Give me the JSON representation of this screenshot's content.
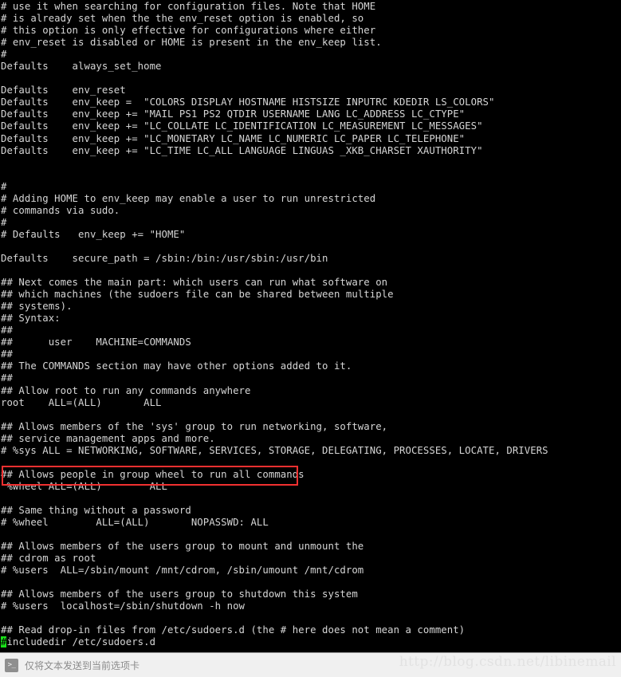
{
  "window": {
    "background": "#000000",
    "foreground": "#d6d6d6",
    "highlight_color": "#f23030",
    "cursor_color": "#19e019"
  },
  "terminal": {
    "cursor": {
      "line_index": 53,
      "column": 0,
      "character": "#"
    },
    "lines": [
      "# use it when searching for configuration files. Note that HOME",
      "# is already set when the the env_reset option is enabled, so",
      "# this option is only effective for configurations where either",
      "# env_reset is disabled or HOME is present in the env_keep list.",
      "#",
      "Defaults    always_set_home",
      "",
      "Defaults    env_reset",
      "Defaults    env_keep =  \"COLORS DISPLAY HOSTNAME HISTSIZE INPUTRC KDEDIR LS_COLORS\"",
      "Defaults    env_keep += \"MAIL PS1 PS2 QTDIR USERNAME LANG LC_ADDRESS LC_CTYPE\"",
      "Defaults    env_keep += \"LC_COLLATE LC_IDENTIFICATION LC_MEASUREMENT LC_MESSAGES\"",
      "Defaults    env_keep += \"LC_MONETARY LC_NAME LC_NUMERIC LC_PAPER LC_TELEPHONE\"",
      "Defaults    env_keep += \"LC_TIME LC_ALL LANGUAGE LINGUAS _XKB_CHARSET XAUTHORITY\"",
      "",
      "",
      "#",
      "# Adding HOME to env_keep may enable a user to run unrestricted",
      "# commands via sudo.",
      "#",
      "# Defaults   env_keep += \"HOME\"",
      "",
      "Defaults    secure_path = /sbin:/bin:/usr/sbin:/usr/bin",
      "",
      "## Next comes the main part: which users can run what software on",
      "## which machines (the sudoers file can be shared between multiple",
      "## systems).",
      "## Syntax:",
      "##",
      "##      user    MACHINE=COMMANDS",
      "##",
      "## The COMMANDS section may have other options added to it.",
      "##",
      "## Allow root to run any commands anywhere",
      "root    ALL=(ALL)       ALL",
      "",
      "## Allows members of the 'sys' group to run networking, software,",
      "## service management apps and more.",
      "# %sys ALL = NETWORKING, SOFTWARE, SERVICES, STORAGE, DELEGATING, PROCESSES, LOCATE, DRIVERS",
      "",
      "## Allows people in group wheel to run all commands",
      " %wheel ALL=(ALL)        ALL",
      "",
      "## Same thing without a password",
      "# %wheel        ALL=(ALL)       NOPASSWD: ALL",
      "",
      "## Allows members of the users group to mount and unmount the",
      "## cdrom as root",
      "# %users  ALL=/sbin/mount /mnt/cdrom, /sbin/umount /mnt/cdrom",
      "",
      "## Allows members of the users group to shutdown this system",
      "# %users  localhost=/sbin/shutdown -h now",
      "",
      "## Read drop-in files from /etc/sudoers.d (the # here does not mean a comment)",
      "#includedir /etc/sudoers.d"
    ],
    "highlight": {
      "line_index": 40,
      "text": " %wheel ALL=(ALL)        ALL"
    }
  },
  "statusbar": {
    "icon": "terminal-prompt-icon",
    "icon_glyph": ">_",
    "label": "仅将文本发送到当前选项卡"
  },
  "watermark": {
    "text": "http://blog.csdn.net/libinemail"
  }
}
